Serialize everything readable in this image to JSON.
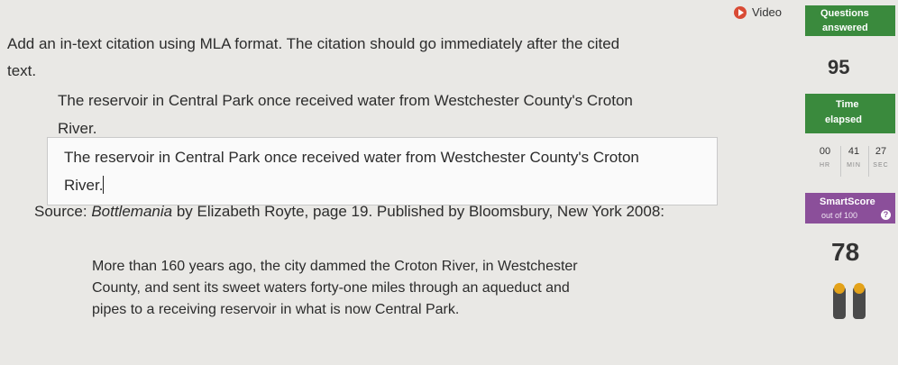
{
  "prompt": {
    "line1": "Add an in-text citation using MLA format. The citation should go immediately after the cited",
    "line2": "text."
  },
  "quote": {
    "line1": "The reservoir in Central Park once received water from Westchester County's Croton",
    "line2": "River."
  },
  "answer": {
    "line1": "The reservoir in Central Park once received water from Westchester County's Croton",
    "line2": "River."
  },
  "source": {
    "prefix": "Source: ",
    "title": "Bottlemania",
    "rest": " by Elizabeth Royte, page 19. Published by Bloomsbury, New York 2008:"
  },
  "passage": {
    "line1": "More than 160 years ago, the city dammed the Croton River, in Westchester",
    "line2": "County, and sent its sweet waters forty-one miles through an aqueduct and",
    "line3": "pipes to a receiving reservoir in what is now Central Park."
  },
  "video": {
    "label": "Video",
    "icon": "play-icon",
    "color": "#d94b35"
  },
  "questions": {
    "title": "Questions",
    "subtitle": "answered",
    "count": "95",
    "color": "#3a8a3d"
  },
  "time": {
    "title": "Time",
    "subtitle": "elapsed",
    "hr": "00",
    "min": "41",
    "sec": "27",
    "hr_label": "HR",
    "min_label": "MIN",
    "sec_label": "SEC",
    "color": "#3a8a3d"
  },
  "smartscore": {
    "title": "SmartScore",
    "subtitle": "out of 100",
    "info": "?",
    "value": "78",
    "color": "#8b4f9a",
    "icon": "medal-icon"
  }
}
